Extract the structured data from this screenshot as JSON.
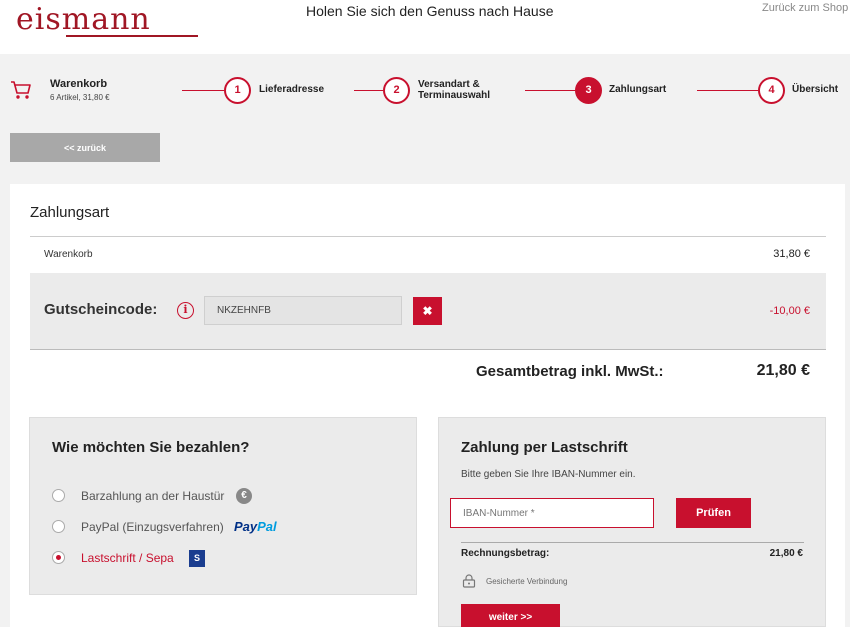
{
  "header": {
    "logo": "eismann",
    "tagline": "Holen Sie sich den Genuss nach Hause",
    "back_to_shop": "Zurück zum Shop"
  },
  "steps": {
    "cart_title": "Warenkorb",
    "cart_summary": "6 Artikel, 31,80 €",
    "items": [
      {
        "number": "1",
        "label_line1": "Lieferadresse",
        "label_line2": "",
        "active": false
      },
      {
        "number": "2",
        "label_line1": "Versandart &",
        "label_line2": "Terminauswahl",
        "active": false
      },
      {
        "number": "3",
        "label_line1": "Zahlungsart",
        "label_line2": "",
        "active": true
      },
      {
        "number": "4",
        "label_line1": "Übersicht",
        "label_line2": "",
        "active": false
      }
    ]
  },
  "back_button": "<< zurück",
  "payment": {
    "title": "Zahlungsart",
    "cart_label": "Warenkorb",
    "cart_amount": "31,80 €",
    "coupon_label": "Gutscheincode:",
    "coupon_value": "NKZEHNFB",
    "remove_symbol": "✖",
    "discount": "-10,00 €",
    "total_label": "Gesamtbetrag inkl. MwSt.:",
    "total_amount": "21,80 €"
  },
  "methods": {
    "title": "Wie möchten Sie bezahlen?",
    "options": [
      {
        "label": "Barzahlung an der Haustür",
        "icon": "euro-icon",
        "checked": false
      },
      {
        "label": "PayPal (Einzugsverfahren)",
        "icon": "paypal-logo",
        "checked": false
      },
      {
        "label": "Lastschrift / Sepa",
        "icon": "sepa-icon",
        "checked": true
      }
    ],
    "euro_symbol": "€",
    "paypal_part1": "Pay",
    "paypal_part2": "Pal",
    "sepa_symbol": "S"
  },
  "sepa": {
    "title": "Zahlung per Lastschrift",
    "hint": "Bitte geben Sie Ihre IBAN-Nummer ein.",
    "iban_placeholder": "IBAN-Nummer *",
    "check_button": "Prüfen",
    "invoice_label": "Rechnungsbetrag:",
    "invoice_amount": "21,80 €",
    "secure_text": "Gesicherte Verbindung",
    "next_button": "weiter >>"
  },
  "colors": {
    "brand": "#c8102e",
    "logo": "#a01624",
    "paypal_dark": "#003087",
    "paypal_light": "#009cde"
  }
}
